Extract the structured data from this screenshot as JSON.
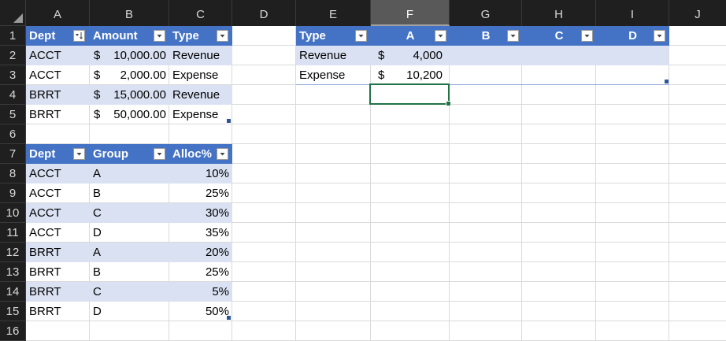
{
  "sheet": {
    "columns": [
      "A",
      "B",
      "C",
      "D",
      "E",
      "F",
      "G",
      "H",
      "I",
      "J"
    ],
    "rows": [
      "1",
      "2",
      "3",
      "4",
      "5",
      "6",
      "7",
      "8",
      "9",
      "10",
      "11",
      "12",
      "13",
      "14",
      "15",
      "16"
    ],
    "selected_column": "F",
    "selected_cell": "F4"
  },
  "table1": {
    "headers": [
      "Dept",
      "Amount",
      "Type"
    ],
    "rows": [
      {
        "dept": "ACCT",
        "currency": "$",
        "amount": "10,000.00",
        "type": "Revenue"
      },
      {
        "dept": "ACCT",
        "currency": "$",
        "amount": "2,000.00",
        "type": "Expense"
      },
      {
        "dept": "BRRT",
        "currency": "$",
        "amount": "15,000.00",
        "type": "Revenue"
      },
      {
        "dept": "BRRT",
        "currency": "$",
        "amount": "50,000.00",
        "type": "Expense"
      }
    ]
  },
  "table2": {
    "headers": [
      "Dept",
      "Group",
      "Alloc%"
    ],
    "rows": [
      {
        "dept": "ACCT",
        "group": "A",
        "alloc": "10%"
      },
      {
        "dept": "ACCT",
        "group": "B",
        "alloc": "25%"
      },
      {
        "dept": "ACCT",
        "group": "C",
        "alloc": "30%"
      },
      {
        "dept": "ACCT",
        "group": "D",
        "alloc": "35%"
      },
      {
        "dept": "BRRT",
        "group": "A",
        "alloc": "20%"
      },
      {
        "dept": "BRRT",
        "group": "B",
        "alloc": "25%"
      },
      {
        "dept": "BRRT",
        "group": "C",
        "alloc": "5%"
      },
      {
        "dept": "BRRT",
        "group": "D",
        "alloc": "50%"
      }
    ]
  },
  "table3": {
    "headers": [
      "Type",
      "A",
      "B",
      "C",
      "D"
    ],
    "rows": [
      {
        "type": "Revenue",
        "currency": "$",
        "a": "4,000"
      },
      {
        "type": "Expense",
        "currency": "$",
        "a": "10,200"
      }
    ]
  },
  "icons": {
    "filter": "filter-dropdown-icon",
    "sorted_filter": "sort-filter-icon",
    "select_all": "select-all-triangle-icon",
    "resize": "table-resize-handle-icon"
  },
  "colors": {
    "table_header": "#4472c4",
    "band": "#d9e1f2",
    "header_bg": "#1f1f1f",
    "selection": "#217346"
  }
}
